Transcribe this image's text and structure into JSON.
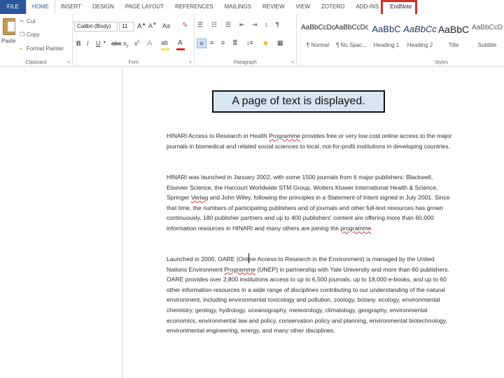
{
  "tabs": [
    "FILE",
    "HOME",
    "INSERT",
    "DESIGN",
    "PAGE LAYOUT",
    "REFERENCES",
    "MAILINGS",
    "REVIEW",
    "VIEW",
    "ZOTERO",
    "ADD-INS",
    "EndNote"
  ],
  "clipboard": {
    "paste": "Paste",
    "cut": "Cut",
    "copy": "Copy",
    "format_painter": "Format Painter",
    "label": "Clipboard"
  },
  "font": {
    "name": "Calibri (Body)",
    "size": "11",
    "label": "Font",
    "change_case": "Aa"
  },
  "paragraph": {
    "label": "Paragraph"
  },
  "styles": {
    "label": "Styles",
    "items": [
      {
        "sample": "AaBbCcDc",
        "name": "¶ Normal"
      },
      {
        "sample": "AaBbCcDc",
        "name": "¶ No Spac..."
      },
      {
        "sample": "AaBbC",
        "name": "Heading 1"
      },
      {
        "sample": "AaBbCc",
        "name": "Heading 2"
      },
      {
        "sample": "AaBbC",
        "name": "Title"
      },
      {
        "sample": "AaBbCcD",
        "name": "Subtitle"
      }
    ]
  },
  "caption": "A page of text is displayed.",
  "document": {
    "para1": {
      "before": "HINARI Access to Research in Health ",
      "sq": "Programme",
      "after": " provides free or very low cost online access to the major journals in biomedical and related social sciences to local, not-for-profit institutions in developing countries."
    },
    "para2": {
      "text1": "HINARI was launched in January 2002, with some 1500 journals from 6 major publishers: Blackwell, Elsevier Science, the Harcourt Worldwide STM Group, Wolters Kluwer International Health & Science, Springer ",
      "sq1": "Verlag",
      "text2": " and John Wiley, following the principles in a Statement of Intent signed in July 2001. Since that time, the numbers of participating publishers and of journals and other full-text resources has grown continuously. 180 publisher partners and up to 400 publishers' content are offering more than 60,000 information resources in HINARI and many others are joining the ",
      "sq2": "programme",
      "text3": "."
    },
    "para3": {
      "text1": "Launched in 2006, OARE (Online Access to Research in the Environment) is managed by the United Nations Environment ",
      "sq1": "Programme",
      "text2": " (UNEP) in partnership with Yale University and more than 60 publishers. OARE provides over 2,800 institutions access to up to 6,500 journals, up to 18,000 e-books, and up to 60 other information resources in a wide range of disciplines contributing to our understanding of the natural environment, including environmental toxicology and pollution, zoology, botany, ecology, environmental chemistry, geology, hydrology, oceanography, meteorology, climatology, geography, environmental economics, environmental law and policy, conservation policy and planning, environmental biotechnology, environmental engineering, energy, and many other disciplines."
    }
  },
  "colors": {
    "file_tab": "#2b579a",
    "highlight_box": "#d0302b",
    "caption_bg": "#d8e6f2"
  }
}
